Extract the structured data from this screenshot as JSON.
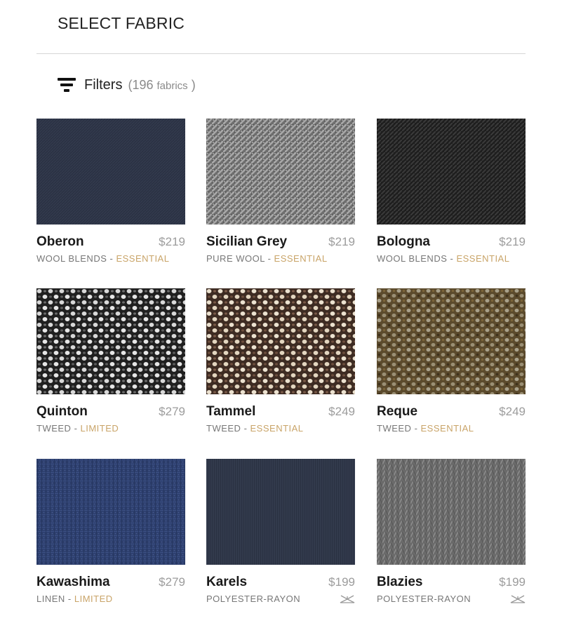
{
  "header": {
    "title": "SELECT FABRIC"
  },
  "filters": {
    "label": "Filters",
    "count_open": "(196",
    "count_unit": "fabrics",
    "count_close": ")"
  },
  "fabrics": [
    {
      "name": "Oberon",
      "price": "$219",
      "material": "WOOL BLENDS",
      "sep": " - ",
      "tier": "ESSENTIAL",
      "icon": ""
    },
    {
      "name": "Sicilian Grey",
      "price": "$219",
      "material": "PURE WOOL",
      "sep": " - ",
      "tier": "ESSENTIAL",
      "icon": ""
    },
    {
      "name": "Bologna",
      "price": "$219",
      "material": "WOOL BLENDS",
      "sep": " - ",
      "tier": "ESSENTIAL",
      "icon": ""
    },
    {
      "name": "Quinton",
      "price": "$279",
      "material": "TWEED",
      "sep": " - ",
      "tier": "LIMITED",
      "icon": ""
    },
    {
      "name": "Tammel",
      "price": "$249",
      "material": "TWEED",
      "sep": " - ",
      "tier": "ESSENTIAL",
      "icon": ""
    },
    {
      "name": "Reque",
      "price": "$249",
      "material": "TWEED",
      "sep": " - ",
      "tier": "ESSENTIAL",
      "icon": ""
    },
    {
      "name": "Kawashima",
      "price": "$279",
      "material": "LINEN",
      "sep": " - ",
      "tier": "LIMITED",
      "icon": ""
    },
    {
      "name": "Karels",
      "price": "$199",
      "material": "POLYESTER-RAYON",
      "sep": "",
      "tier": "",
      "icon": "hanger-icon"
    },
    {
      "name": "Blazies",
      "price": "$199",
      "material": "POLYESTER-RAYON",
      "sep": "",
      "tier": "",
      "icon": "hanger-icon"
    }
  ],
  "colors": {
    "tier_accent": "#c9a468",
    "price": "#9c9c9c",
    "meta": "#777777"
  }
}
